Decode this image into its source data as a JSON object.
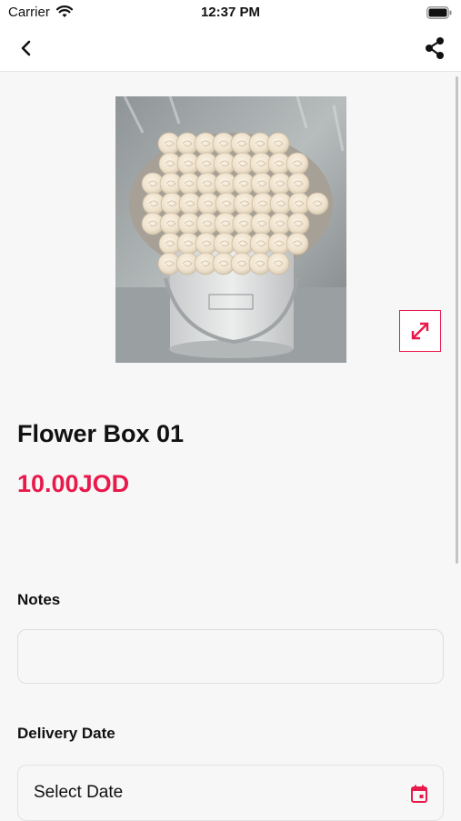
{
  "status_bar": {
    "carrier": "Carrier",
    "time": "12:37 PM",
    "wifi_icon": "wifi-icon",
    "battery_icon": "battery-icon"
  },
  "nav": {
    "back_icon": "chevron-left-icon",
    "share_icon": "share-icon"
  },
  "product": {
    "image": "white roses flower box photo",
    "name": "Flower Box 01",
    "price": "10.00JOD",
    "expand_icon": "expand-icon"
  },
  "form": {
    "notes_label": "Notes",
    "notes_value": "",
    "delivery_label": "Delivery Date",
    "date_placeholder": "Select Date",
    "calendar_icon": "calendar-icon"
  },
  "colors": {
    "accent": "#e8194b",
    "background": "#f7f7f7"
  }
}
